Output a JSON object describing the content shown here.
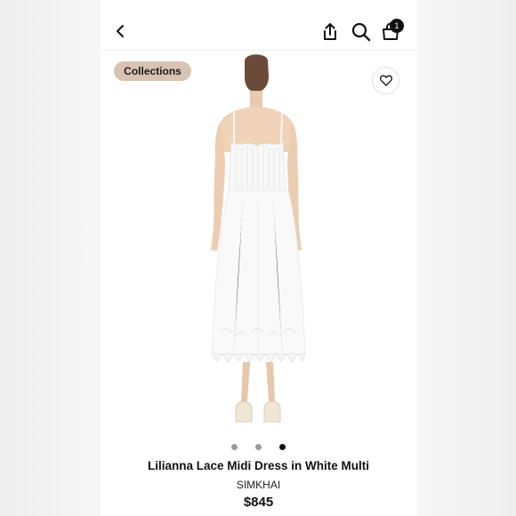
{
  "header": {
    "back_icon": "chevron-left-icon",
    "share_icon": "share-icon",
    "search_icon": "search-icon",
    "bag_icon": "shopping-bag-icon",
    "bag_count": "1"
  },
  "badge": {
    "label": "Collections",
    "color": "#d8c3b2"
  },
  "wishlist": {
    "icon": "heart-icon"
  },
  "carousel": {
    "count": 3,
    "active_index": 2
  },
  "product": {
    "title": "Lilianna Lace Midi Dress in White Multi",
    "brand": "SIMKHAI",
    "price": "$845"
  }
}
